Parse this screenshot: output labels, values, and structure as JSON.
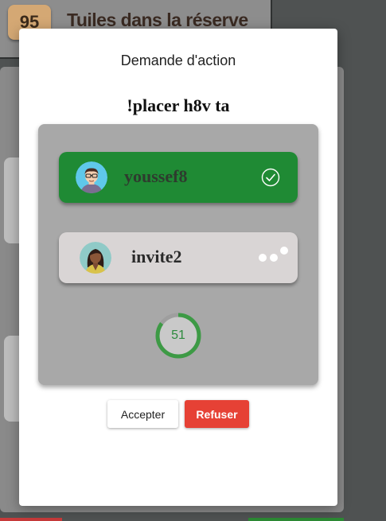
{
  "background": {
    "tile_count": "95",
    "reserve_label": "Tuiles dans la réserve"
  },
  "dialog": {
    "title": "Demande d'action",
    "action_text": "!placer h8v ta",
    "players": [
      {
        "name": "youssef8",
        "status": "accepted",
        "status_icon": "check-circle-icon"
      },
      {
        "name": "invite2",
        "status": "waiting",
        "status_icon": "loading-dots-icon"
      }
    ],
    "timer": {
      "value": "51",
      "remaining_fraction": 0.85
    },
    "buttons": {
      "accept": "Accepter",
      "refuse": "Refuser"
    }
  },
  "colors": {
    "accepted_player": "#1f8a34",
    "waiting_player": "#d9d5d5",
    "refuse_button": "#e64135",
    "timer_ring": "#3d9a45"
  }
}
